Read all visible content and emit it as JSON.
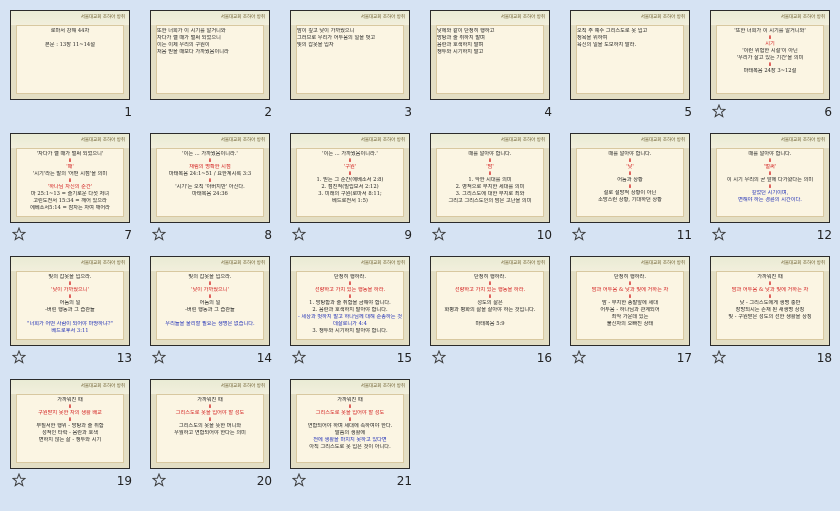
{
  "header_text": "서울대교회 조하아 방취",
  "slides": [
    {
      "number": "1",
      "star": false,
      "align": "center",
      "lines": [
        [
          "",
          "로마서 강해 44차"
        ],
        [
          "",
          ""
        ],
        [
          "",
          "본문 : 13장 11~14절"
        ]
      ]
    },
    {
      "number": "2",
      "star": false,
      "align": "left",
      "lines": [
        [
          "",
          "또한 너희가 이 시기를 알거니와"
        ],
        [
          "",
          "자다가 깰 때가 벌써 되었으니"
        ],
        [
          "",
          "이는 이제 우리의 구원이"
        ],
        [
          "",
          "처음 믿을 때보다 가까웠음이니라"
        ]
      ]
    },
    {
      "number": "3",
      "star": false,
      "align": "left",
      "lines": [
        [
          "",
          "밤이 깊고 낮이 가까웠으니"
        ],
        [
          "",
          "그러므로 우리가 어두움의 일을 벗고"
        ],
        [
          "",
          "빛의 갑옷을 입자"
        ]
      ]
    },
    {
      "number": "4",
      "star": false,
      "align": "left",
      "lines": [
        [
          "",
          "낮에와 같이 단정히 행하고"
        ],
        [
          "",
          "방탕과 술 취하지 말며"
        ],
        [
          "",
          "음란과 호색하지 말며"
        ],
        [
          "",
          "쟁투와 시기하지 말고"
        ]
      ]
    },
    {
      "number": "5",
      "star": false,
      "align": "left",
      "lines": [
        [
          "",
          "오직 주 예수 그리스도로 옷 입고"
        ],
        [
          "",
          "정욕을 위하여"
        ],
        [
          "",
          "육신의 일을 도모하지 말라."
        ]
      ]
    },
    {
      "number": "6",
      "star": true,
      "align": "center",
      "lines": [
        [
          "",
          "'또한 너희가 이 시기를 알거니와'"
        ],
        [
          "a",
          "⬇"
        ],
        [
          "r",
          "시기"
        ],
        [
          "",
          "'이런 위험한 시절'이 아닌"
        ],
        [
          "",
          "'우리가 살고 있는 기간'을 의미"
        ],
        [
          "a",
          "⬇"
        ],
        [
          "",
          "마태복음 24장 3~12절"
        ]
      ]
    },
    {
      "number": "7",
      "star": true,
      "align": "center",
      "lines": [
        [
          "",
          "'자다가 깰 때가 벌써 되었으니'"
        ],
        [
          "a",
          "⬇"
        ],
        [
          "r",
          "'때'"
        ],
        [
          "",
          "'시기'라는 말의 '어떤 시점'을 의미"
        ],
        [
          "a",
          "⬇"
        ],
        [
          "r",
          "'하나님 자신의 순간'"
        ],
        [
          "",
          "마 25:1~13 = 슬기로운 다섯 처녀"
        ],
        [
          "",
          "고린도전서 15:34 = 깨어 있으라"
        ],
        [
          "",
          "에베소서5:14 = 잠자는 자여 깨어라"
        ]
      ]
    },
    {
      "number": "8",
      "star": true,
      "align": "center",
      "lines": [
        [
          "",
          "'이는 ... 가까웠음이니라.'"
        ],
        [
          "a",
          "⬇"
        ],
        [
          "r",
          "재림의 명확한 시점"
        ],
        [
          "",
          "마태복음 24:1~51 / 요한계시록 3:3"
        ],
        [
          "a",
          "⬇"
        ],
        [
          "",
          "'시기'는 오직 '아버지만' 아신다."
        ],
        [
          "",
          "마태복음 24:36"
        ]
      ]
    },
    {
      "number": "9",
      "star": true,
      "align": "center",
      "lines": [
        [
          "",
          "'이는 ... 가까웠음이니라.'"
        ],
        [
          "a",
          "⬇"
        ],
        [
          "r",
          "'구원'"
        ],
        [
          "a",
          "⬇"
        ],
        [
          "",
          "1. 믿는 그 순간(에베소서 2:8)"
        ],
        [
          "",
          "2. 점진적(빌립보서 2:12)"
        ],
        [
          "",
          "3. 미래의 구원(로마서 8:11;"
        ],
        [
          "",
          "   베드로전서 1:5)"
        ]
      ]
    },
    {
      "number": "10",
      "star": true,
      "align": "center",
      "lines": [
        [
          "",
          "때를 알아야 합니다."
        ],
        [
          "a",
          "⬇"
        ],
        [
          "r",
          "'밤'"
        ],
        [
          "a",
          "⬇"
        ],
        [
          "",
          "1. 악한 시대를 의미"
        ],
        [
          "",
          "2. 영적으로 무지한 세대를 의미"
        ],
        [
          "",
          "3. 그리스도에 대한 무지로 죄와"
        ],
        [
          "",
          "그리고 그리스도인의 밤은 고난을 의미"
        ]
      ]
    },
    {
      "number": "11",
      "star": true,
      "align": "center",
      "lines": [
        [
          "",
          "때를 알아야 합니다."
        ],
        [
          "a",
          "⬇"
        ],
        [
          "r",
          "'낮'"
        ],
        [
          "a",
          "⬇"
        ],
        [
          "",
          "어둠과 상황"
        ],
        [
          "a",
          "⬇"
        ],
        [
          "",
          "절로 절망적 상황이 아닌"
        ],
        [
          "",
          "소망스런 상황, 기대하던 상황"
        ]
      ]
    },
    {
      "number": "12",
      "star": true,
      "align": "center",
      "lines": [
        [
          "",
          "때를 알아야 합니다."
        ],
        [
          "a",
          "⬇"
        ],
        [
          "r",
          "'벌써'"
        ],
        [
          "a",
          "⬇"
        ],
        [
          "",
          "이 시기 우리의 곧 앞에 다가왔다는 의미"
        ],
        [
          "a",
          "⬇"
        ],
        [
          "b",
          "깊었던 시기이며,"
        ],
        [
          "b",
          "변해야 하는 경륜의 시간이다."
        ]
      ]
    },
    {
      "number": "13",
      "star": true,
      "align": "center",
      "lines": [
        [
          "",
          "빛의 갑옷을 입으라."
        ],
        [
          "a",
          "⬇"
        ],
        [
          "r",
          "'낮이 가까웠으니'"
        ],
        [
          "a",
          "⬇"
        ],
        [
          "",
          "어둠의 일"
        ],
        [
          "",
          "-버린 행동과 그 습관들"
        ],
        [
          "",
          ""
        ],
        [
          "b",
          "\"너희가 어떤 사람이 되어야 마땅하냐?\""
        ],
        [
          "b",
          "베드로후서 3:11"
        ]
      ]
    },
    {
      "number": "14",
      "star": true,
      "align": "center",
      "lines": [
        [
          "",
          "빛의 갑옷을 입으라."
        ],
        [
          "a",
          "⬇"
        ],
        [
          "r",
          "'낮이 가까웠으니'"
        ],
        [
          "a",
          "⬇"
        ],
        [
          "",
          "어둠의 일"
        ],
        [
          "",
          "-버린 행동과 그 습관들"
        ],
        [
          "",
          ""
        ],
        [
          "b",
          "우리들을 울리할 필요는 생명은 없습니다."
        ]
      ]
    },
    {
      "number": "15",
      "star": true,
      "align": "center",
      "lines": [
        [
          "",
          "단정히 행하라."
        ],
        [
          "a",
          "⬇"
        ],
        [
          "r",
          "선량하고 가치 있는 행동을 하라."
        ],
        [
          "a",
          "⬇"
        ],
        [
          "",
          "1. 방탕함과 술 취함을 금해야 합니다."
        ],
        [
          "",
          "2. 음란과 호색하지 말아야 합니다."
        ],
        [
          "b",
          "- 세상과 벗하지 말고 하나님께 대해 순종하는 것"
        ],
        [
          "b",
          "  데살로니가 4:4"
        ],
        [
          "",
          "3. 쟁투와 시기하지 말아야 합니다."
        ]
      ]
    },
    {
      "number": "16",
      "star": true,
      "align": "center",
      "lines": [
        [
          "",
          "단정히 행하라."
        ],
        [
          "a",
          "⬇"
        ],
        [
          "r",
          "선량하고 가치 있는 행동을 하라."
        ],
        [
          "a",
          "⬇"
        ],
        [
          "",
          "성도의 삶은"
        ],
        [
          "",
          "화평과 평화의 삶을 살아야 하는 것입니다."
        ],
        [
          "",
          ""
        ],
        [
          "",
          "마태복음 5:9"
        ]
      ]
    },
    {
      "number": "17",
      "star": true,
      "align": "center",
      "lines": [
        [
          "",
          "단정히 행하라."
        ],
        [
          "a",
          "⬇"
        ],
        [
          "r",
          "밤과 어두움 & 낮과 빛에 거하는 자"
        ],
        [
          "a",
          "⬇"
        ],
        [
          "",
          "밤 - 무지한 종말앞에 세대"
        ],
        [
          "",
          "어두움 - 하나님과 관계되어"
        ],
        [
          "",
          "      죄악 가운데 있는"
        ],
        [
          "",
          "      불신자의 오빠진 상태"
        ]
      ]
    },
    {
      "number": "18",
      "star": true,
      "align": "center",
      "lines": [
        [
          "",
          "가까워진 때"
        ],
        [
          "a",
          "⬇"
        ],
        [
          "r",
          "밤과 어두움 & 낮과 빛에 거하는 자"
        ],
        [
          "a",
          "⬇"
        ],
        [
          "",
          "낮 - 그리스도에게 생명 충만"
        ],
        [
          "",
          "    장망되시는 존재 된 새생명 상징"
        ],
        [
          "",
          "빛 - 구원받은 성도의 선한 생활을 상징"
        ]
      ]
    },
    {
      "number": "19",
      "star": true,
      "align": "center",
      "lines": [
        [
          "",
          "가까워진 때"
        ],
        [
          "a",
          "⬇"
        ],
        [
          "r",
          "구원받지 못한 자의 생활 배교"
        ],
        [
          "a",
          "⬇"
        ],
        [
          "",
          "무질서한 행위 - 방탕과 술 취함"
        ],
        [
          "",
          "성적인 타락 - 음란과 호색"
        ],
        [
          "",
          "변하지 않는 삶 - 쟁투와 시기"
        ]
      ]
    },
    {
      "number": "20",
      "star": true,
      "align": "center",
      "lines": [
        [
          "",
          "가까워진 때"
        ],
        [
          "a",
          "⬇"
        ],
        [
          "r",
          "그리스도로 옷을 입어야 할 성도"
        ],
        [
          "a",
          "⬇"
        ],
        [
          "",
          "그리스도의 옷을 뜻한 머니와"
        ],
        [
          "",
          "우월하고 연합되어야 한다는 의미"
        ]
      ]
    },
    {
      "number": "21",
      "star": true,
      "align": "center",
      "lines": [
        [
          "",
          "가까워진 때"
        ],
        [
          "a",
          "⬇"
        ],
        [
          "r",
          "그리스도로 옷을 입어야 할 성도"
        ],
        [
          "a",
          "⬇"
        ],
        [
          "",
          "연합되어야 하며 세대에 속하여야 한다."
        ],
        [
          "",
          "말씀의 생활에"
        ],
        [
          "b",
          "전에 생활을 마치지 못하고 있다면"
        ],
        [
          "",
          "아직 그리스도로 옷 입은 것이 아니다."
        ]
      ]
    }
  ]
}
